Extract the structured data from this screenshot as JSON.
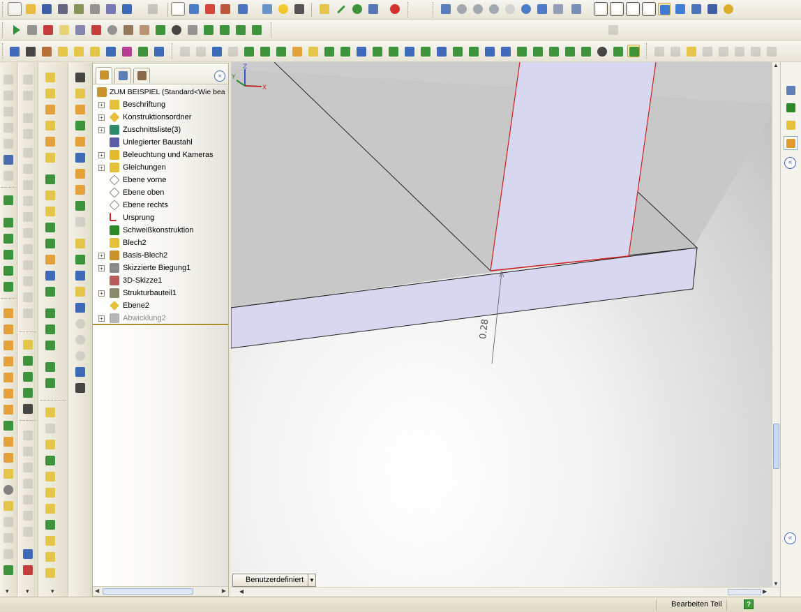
{
  "feature_manager": {
    "root": "ZUM BEISPIEL  (Standard<Wie bea",
    "items": [
      {
        "label": "Beschriftung",
        "expandable": true
      },
      {
        "label": "Konstruktionsordner",
        "expandable": true
      },
      {
        "label": "Zuschnittsliste(3)",
        "expandable": true
      },
      {
        "label": "Unlegierter Baustahl",
        "expandable": false
      },
      {
        "label": "Beleuchtung und Kameras",
        "expandable": true
      },
      {
        "label": "Gleichungen",
        "expandable": true
      },
      {
        "label": "Ebene vorne",
        "expandable": false
      },
      {
        "label": "Ebene oben",
        "expandable": false
      },
      {
        "label": "Ebene rechts",
        "expandable": false
      },
      {
        "label": "Ursprung",
        "expandable": false
      },
      {
        "label": "Schweißkonstruktion",
        "expandable": false
      },
      {
        "label": "Blech2",
        "expandable": false
      },
      {
        "label": "Basis-Blech2",
        "expandable": true
      },
      {
        "label": "Skizzierte Biegung1",
        "expandable": true
      },
      {
        "label": "3D-Skizze1",
        "expandable": false
      },
      {
        "label": "Strukturbauteil1",
        "expandable": true
      },
      {
        "label": "Ebene2",
        "expandable": false
      },
      {
        "label": "Abwicklung2",
        "expandable": true
      }
    ]
  },
  "viewport": {
    "dimension_value": "0.28",
    "configuration": "Benutzerdefiniert",
    "triad": {
      "x": "X",
      "y": "Y",
      "z": "Z"
    }
  },
  "status_bar": {
    "mode": "Bearbeiten Teil",
    "help": "?"
  },
  "colors": {
    "face_fill": "#d5d5ee",
    "edge_highlight": "#d21c1c",
    "rollback_bar": "#e7c23c"
  }
}
